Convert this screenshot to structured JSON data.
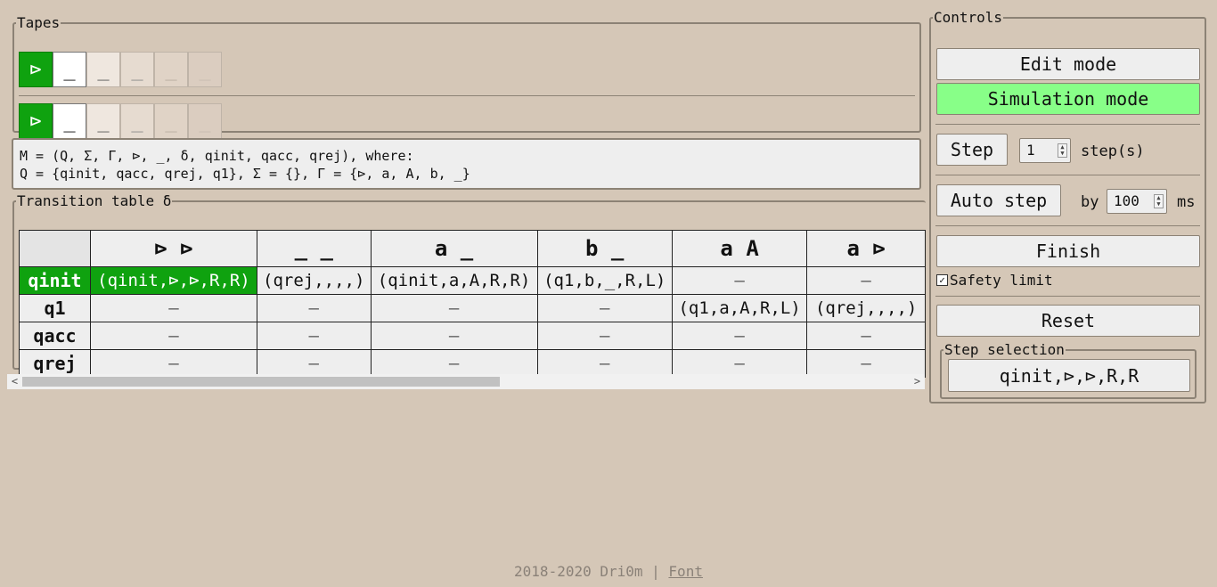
{
  "tapes": {
    "legend": "Tapes",
    "tape1": [
      "⊳",
      "_",
      "_",
      "_",
      "_",
      "_"
    ],
    "tape2": [
      "⊳",
      "_",
      "_",
      "_",
      "_",
      "_"
    ]
  },
  "definition": {
    "line1": "M = (Q, Σ, Γ, ⊳, _, δ, qinit, qacc, qrej), where:",
    "line2": "Q = {qinit, qacc, qrej, q1}, Σ = {}, Γ = {⊳, a, A, b, _}"
  },
  "transitions": {
    "legend": "Transition table δ",
    "headers": [
      "",
      "⊳ ⊳",
      "_ _",
      "a _",
      "b _",
      "a A",
      "a ⊳"
    ],
    "rows": [
      {
        "state": "qinit",
        "cells": [
          "(qinit,⊳,⊳,R,R)",
          "(qrej,,,,)",
          "(qinit,a,A,R,R)",
          "(q1,b,_,R,L)",
          "–",
          "–"
        ]
      },
      {
        "state": "q1",
        "cells": [
          "–",
          "–",
          "–",
          "–",
          "(q1,a,A,R,L)",
          "(qrej,,,,)"
        ]
      },
      {
        "state": "qacc",
        "cells": [
          "–",
          "–",
          "–",
          "–",
          "–",
          "–"
        ]
      },
      {
        "state": "qrej",
        "cells": [
          "–",
          "–",
          "–",
          "–",
          "–",
          "–"
        ]
      }
    ]
  },
  "controls": {
    "legend": "Controls",
    "edit_mode": "Edit mode",
    "simulation_mode": "Simulation mode",
    "step": "Step",
    "step_count": "1",
    "steps_label": "step(s)",
    "auto_step": "Auto step",
    "by_label": "by",
    "interval": "100",
    "ms_label": "ms",
    "finish": "Finish",
    "safety_limit": "Safety limit",
    "reset": "Reset",
    "step_selection_legend": "Step selection",
    "step_selection_value": "qinit,⊳,⊳,R,R"
  },
  "footer": {
    "text": "2018-2020 Dri0m | ",
    "link": "Font"
  },
  "colors": {
    "background": "#d5c7b7",
    "active": "#0fa20f",
    "simulation_on": "#88ff88"
  }
}
